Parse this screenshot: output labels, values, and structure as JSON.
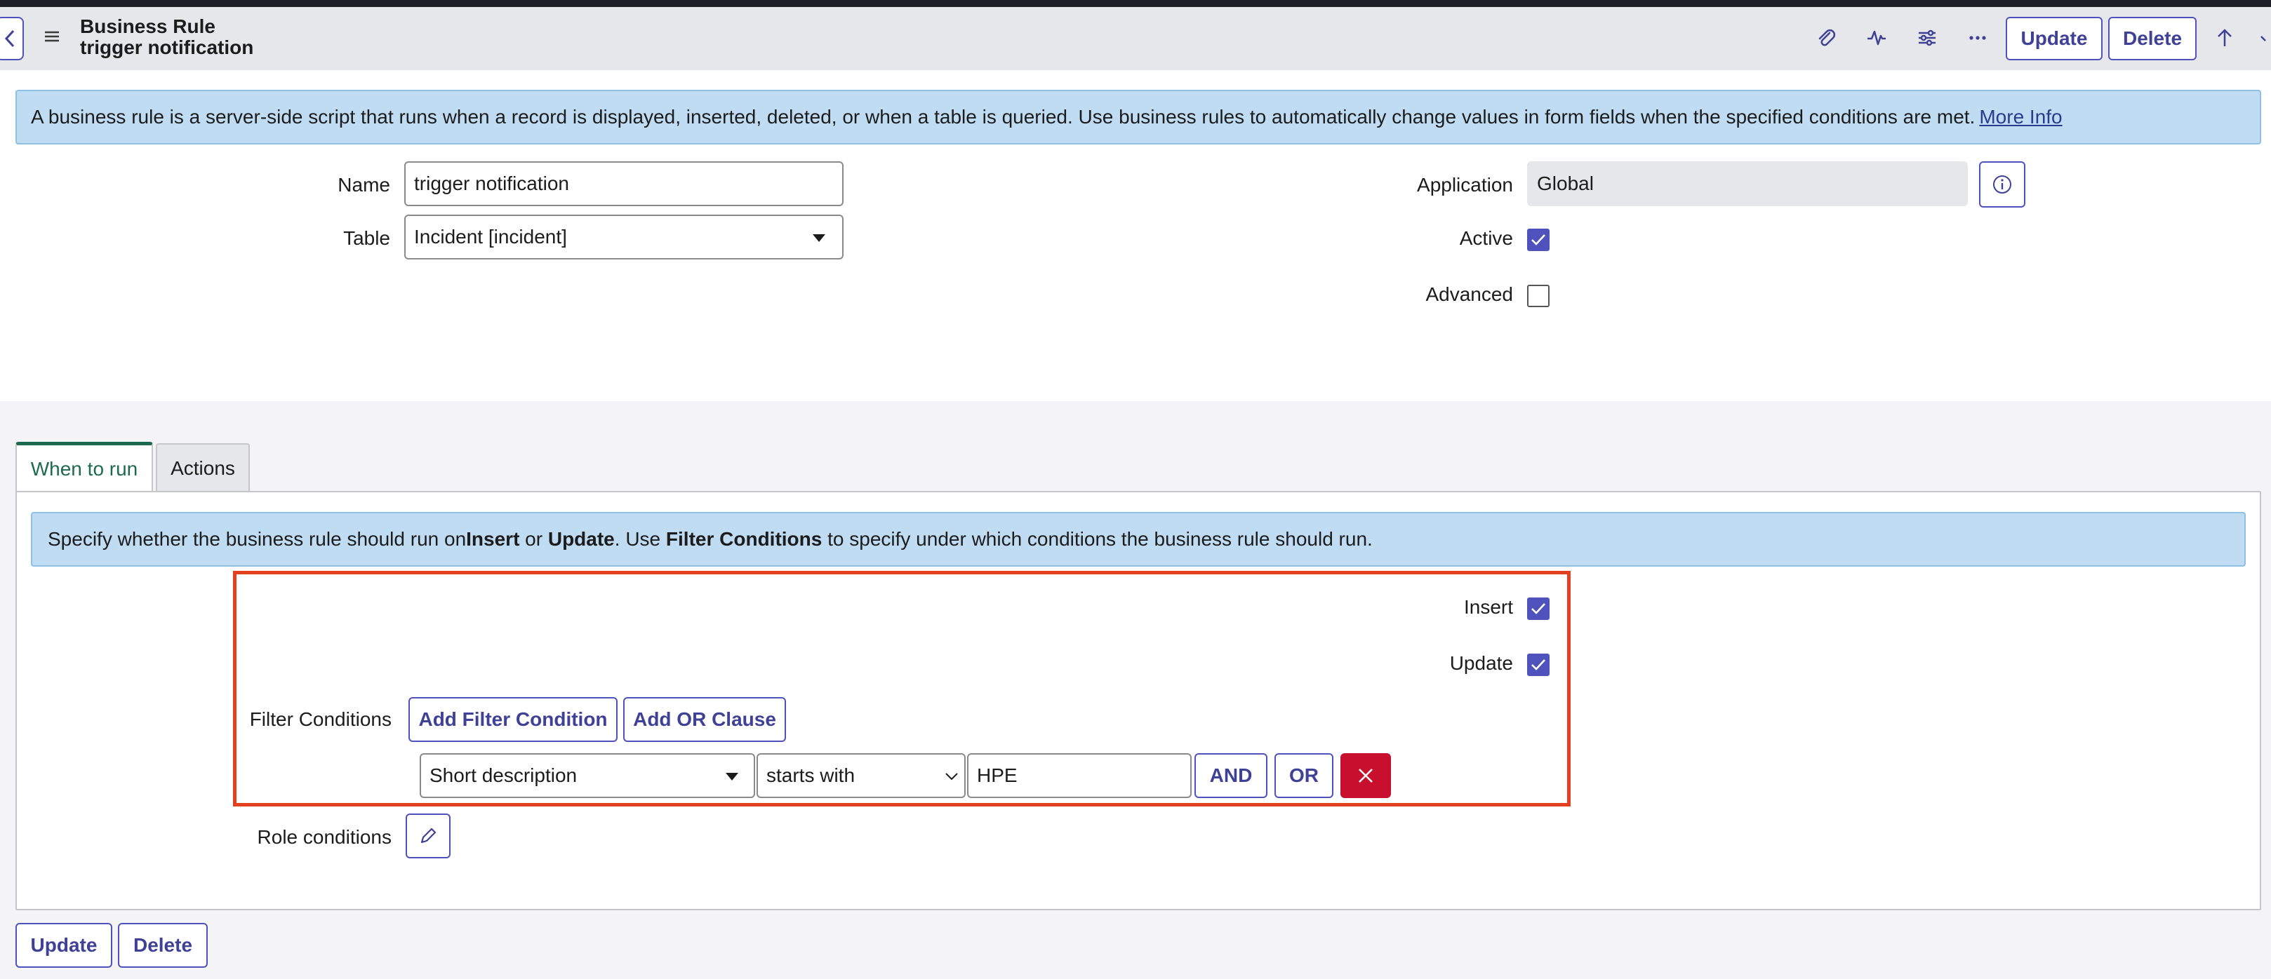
{
  "header": {
    "title": "Business Rule",
    "subtitle": "trigger notification",
    "update_label": "Update",
    "delete_label": "Delete"
  },
  "info": {
    "text": "A business rule is a server-side script that runs when a record is displayed, inserted, deleted, or when a table is queried. Use business rules to automatically change values in form fields when the specified conditions are met.",
    "link": "More Info"
  },
  "form": {
    "name_label": "Name",
    "name_value": "trigger notification",
    "table_label": "Table",
    "table_value": "Incident [incident]",
    "application_label": "Application",
    "application_value": "Global",
    "active_label": "Active",
    "active_checked": true,
    "advanced_label": "Advanced",
    "advanced_checked": false
  },
  "tabs": [
    {
      "label": "When to run",
      "active": true
    },
    {
      "label": "Actions",
      "active": false
    }
  ],
  "when": {
    "info_parts": [
      "Specify whether the business rule should run on ",
      "Insert",
      " or ",
      "Update",
      ". Use ",
      "Filter Conditions",
      " to specify under which conditions the business rule should run."
    ],
    "insert_label": "Insert",
    "insert_checked": true,
    "update_label": "Update",
    "update_checked": true,
    "filter_label": "Filter Conditions",
    "add_filter_label": "Add Filter Condition",
    "add_or_label": "Add OR Clause",
    "condition": {
      "field": "Short description",
      "operator": "starts with",
      "value": "HPE",
      "and_label": "AND",
      "or_label": "OR"
    },
    "role_label": "Role conditions"
  },
  "footer": {
    "update_label": "Update",
    "delete_label": "Delete"
  },
  "colors": {
    "accent": "#4f52bd",
    "info_bg": "#bfdcf3",
    "highlight": "#e2401f",
    "danger": "#c8102e",
    "tab_active": "#1d6b4c"
  }
}
